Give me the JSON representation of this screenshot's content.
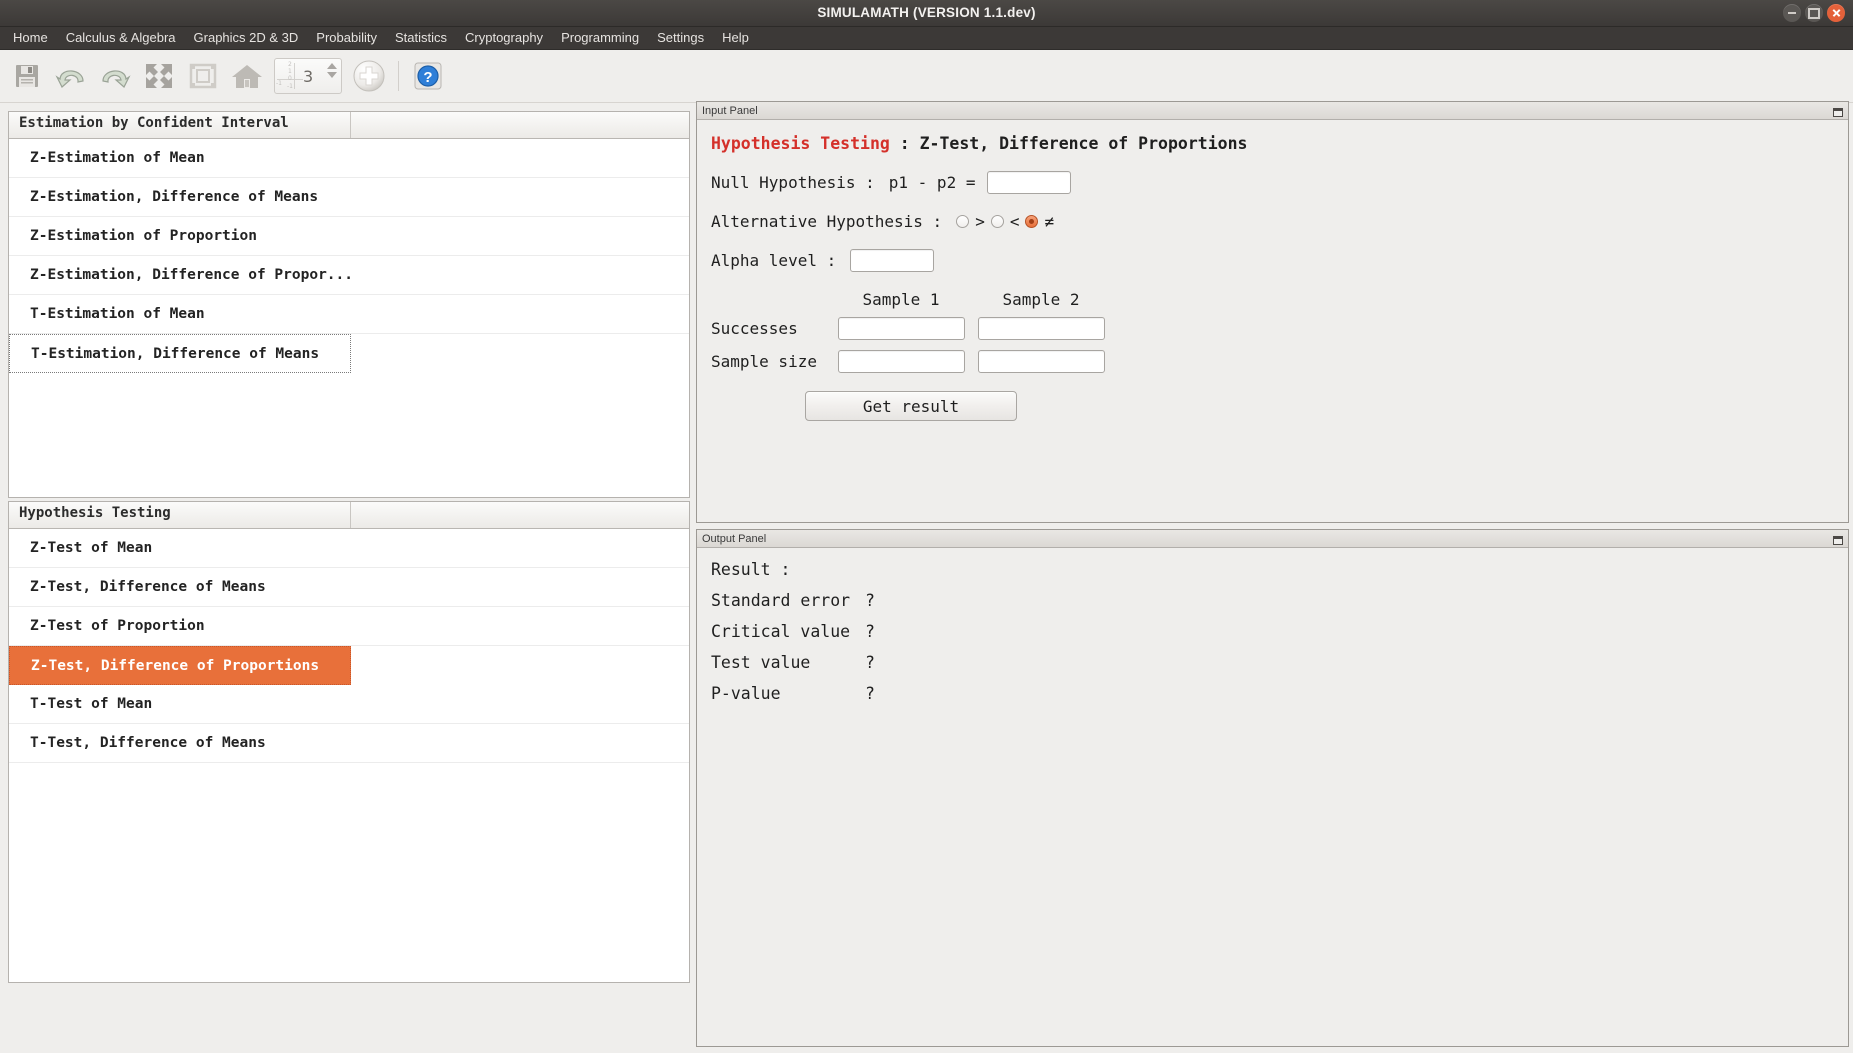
{
  "window": {
    "title": "SIMULAMATH   (VERSION 1.1.dev)",
    "controls": {
      "minimize": "minimize-button",
      "maximize": "maximize-button",
      "close": "close-button"
    }
  },
  "menubar": {
    "items": [
      {
        "label": "Home"
      },
      {
        "label": "Calculus & Algebra"
      },
      {
        "label": "Graphics 2D & 3D"
      },
      {
        "label": "Probability"
      },
      {
        "label": "Statistics"
      },
      {
        "label": "Cryptography"
      },
      {
        "label": "Programming"
      },
      {
        "label": "Settings"
      },
      {
        "label": "Help"
      }
    ]
  },
  "toolbar": {
    "buttons": [
      {
        "icon": "save-icon"
      },
      {
        "icon": "undo-icon"
      },
      {
        "icon": "redo-icon"
      },
      {
        "icon": "expand-arrows-icon"
      },
      {
        "icon": "fit-frame-icon"
      },
      {
        "icon": "home-icon"
      }
    ],
    "spinner": {
      "value": "3",
      "axis_labels": [
        "2",
        "1",
        "0",
        "-1",
        "-1"
      ]
    },
    "zoom_button": {
      "icon": "plus-circle-icon"
    },
    "help_button": {
      "icon": "help-question-icon"
    }
  },
  "left_panel": {
    "estimation": {
      "header": "Estimation by Confident Interval",
      "header_second_column": "",
      "items": [
        {
          "label": "Z-Estimation of Mean",
          "state": "normal"
        },
        {
          "label": "Z-Estimation, Difference of Means",
          "state": "normal"
        },
        {
          "label": "Z-Estimation of Proportion",
          "state": "normal"
        },
        {
          "label": "Z-Estimation, Difference of Propor...",
          "state": "normal"
        },
        {
          "label": "T-Estimation of Mean",
          "state": "normal"
        },
        {
          "label": "T-Estimation, Difference of Means",
          "state": "focused"
        }
      ]
    },
    "hypothesis": {
      "header": "Hypothesis Testing",
      "header_second_column": "",
      "items": [
        {
          "label": "Z-Test of Mean",
          "state": "normal"
        },
        {
          "label": "Z-Test, Difference of Means",
          "state": "normal"
        },
        {
          "label": "Z-Test of Proportion",
          "state": "normal"
        },
        {
          "label": "Z-Test, Difference of Proportions",
          "state": "selected"
        },
        {
          "label": "T-Test of Mean",
          "state": "normal"
        },
        {
          "label": "T-Test, Difference of Means",
          "state": "normal"
        }
      ]
    }
  },
  "input_panel": {
    "dock_title": "Input Panel",
    "heading_red": "Hypothesis Testing",
    "heading_rest": " : Z-Test, Difference of Proportions",
    "null_hypothesis_label": "Null Hypothesis :",
    "null_hypothesis_expr": "p1 - p2 =",
    "null_hypothesis_value": "",
    "alternative_label": "Alternative Hypothesis :",
    "alternatives": [
      {
        "symbol": ">",
        "selected": false
      },
      {
        "symbol": "<",
        "selected": false
      },
      {
        "symbol": "≠",
        "selected": true
      }
    ],
    "alpha_label": "Alpha level :",
    "alpha_value": "",
    "column_headers": [
      "Sample 1",
      "Sample 2"
    ],
    "rows": [
      {
        "label": "Successes",
        "sample1": "",
        "sample2": ""
      },
      {
        "label": "Sample size",
        "sample1": "",
        "sample2": ""
      }
    ],
    "get_result_button": "Get result"
  },
  "output_panel": {
    "dock_title": "Output Panel",
    "result_label": "Result :",
    "lines": [
      {
        "key": "Standard error",
        "value": "?"
      },
      {
        "key": "Critical value",
        "value": "?"
      },
      {
        "key": "Test value",
        "value": "?"
      },
      {
        "key": "P-value",
        "value": "?"
      }
    ]
  },
  "colors": {
    "accent_orange": "#e8703a",
    "heading_red": "#d4302a",
    "titlebar": "#3c3937",
    "panel_bg": "#efeeec",
    "close_button": "#e4613a"
  }
}
